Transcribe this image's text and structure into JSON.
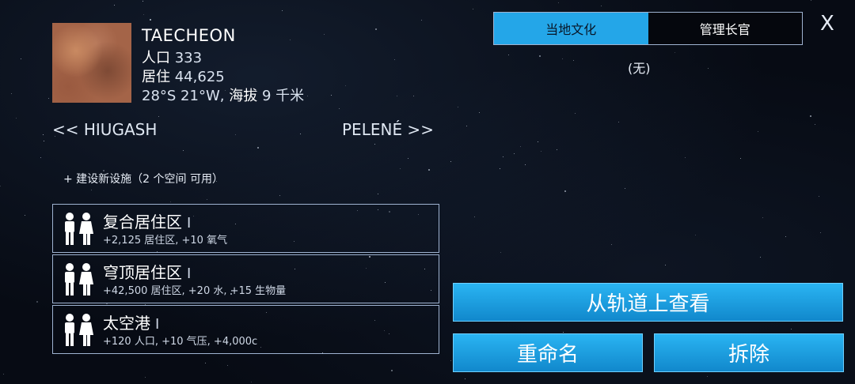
{
  "planet": {
    "name": "TAECHEON",
    "population_label": "人口",
    "population_value": "333",
    "housing_label": "居住",
    "housing_value": "44,625",
    "coords": "28°S 21°W,",
    "altitude_label": "海拔",
    "altitude_value": "9 千米"
  },
  "navigation": {
    "previous": "<< HIUGASH",
    "next": "PELENÉ >>"
  },
  "build_new": "+ 建设新设施（2 个空间 可用）",
  "facilities": [
    {
      "title": "复合居住区",
      "level": "I",
      "description": "+2,125 居住区, +10 氧气"
    },
    {
      "title": "穹顶居住区",
      "level": "I",
      "description": "+42,500 居住区, +20 水, +15 生物量"
    },
    {
      "title": "太空港",
      "level": "I",
      "description": "+120 人口, +10 气压, +4,000c"
    }
  ],
  "tabs": {
    "local_culture": "当地文化",
    "administrator": "管理长官"
  },
  "close_label": "X",
  "none_label": "(无)",
  "buttons": {
    "view_from_orbit": "从轨道上查看",
    "rename": "重命名",
    "demolish": "拆除"
  },
  "colors": {
    "accent": "#24a6e8",
    "border": "#9fb3d1",
    "background": "#070b14"
  },
  "icons": {
    "facility": "people-icon"
  }
}
